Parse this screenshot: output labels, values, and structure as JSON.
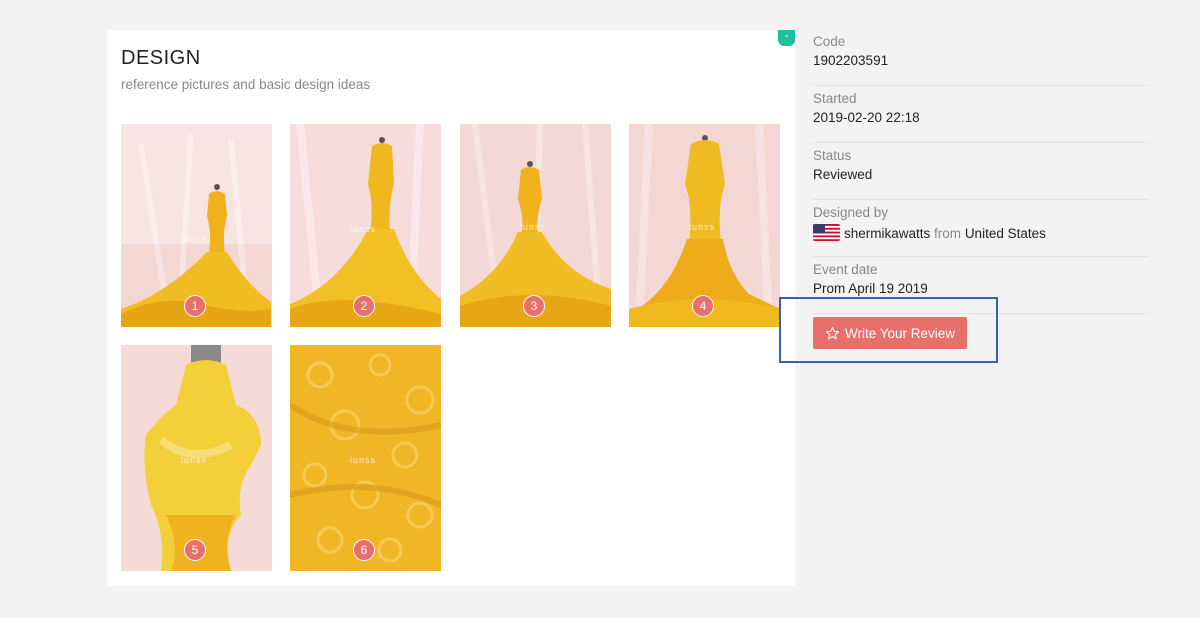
{
  "design": {
    "title": "DESIGN",
    "subtitle": "reference pictures and basic design ideas",
    "corner_tab": "-",
    "watermark": "lunss",
    "thumbnails": [
      {
        "number": "1"
      },
      {
        "number": "2"
      },
      {
        "number": "3"
      },
      {
        "number": "4"
      },
      {
        "number": "5"
      },
      {
        "number": "6"
      }
    ]
  },
  "info": {
    "code": {
      "label": "Code",
      "value": "1902203591"
    },
    "started": {
      "label": "Started",
      "value": "2019-02-20 22:18"
    },
    "status": {
      "label": "Status",
      "value": "Reviewed"
    },
    "designed_by": {
      "label": "Designed by",
      "user": "shermikawatts",
      "from_word": "from",
      "country": "United States",
      "flag_icon": "us-flag-icon"
    },
    "event_date": {
      "label": "Event date",
      "value": "Prom April 19 2019"
    }
  },
  "review_button": {
    "label": "Write Your Review",
    "icon": "star-outline-icon"
  },
  "colors": {
    "accent": "#e8706a",
    "teal": "#1fbf9f",
    "highlight": "#3b5fb8",
    "dress_yellow": "#f0b41e"
  }
}
